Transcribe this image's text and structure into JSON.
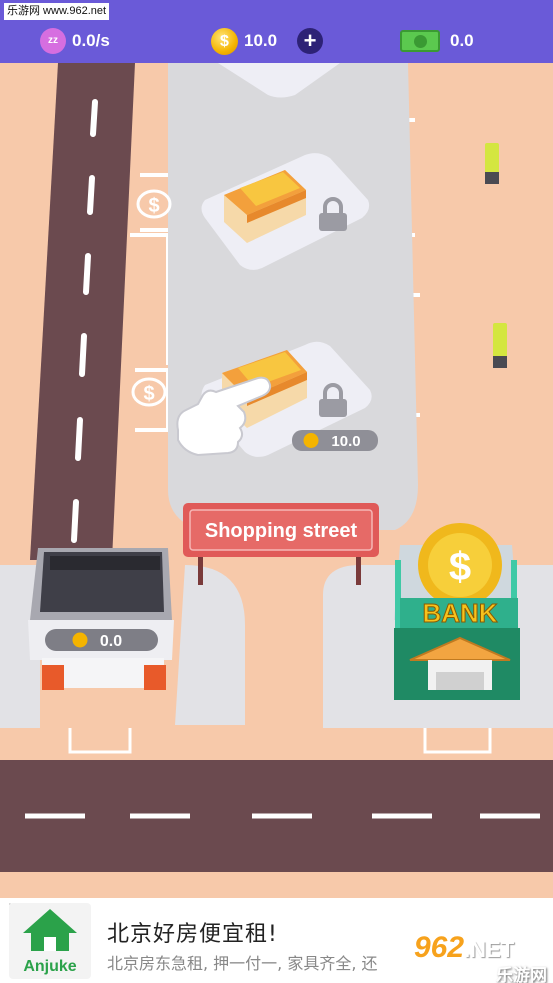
{
  "watermark_top": "乐游网 www.962.net",
  "hud": {
    "energy_rate": "0.0/s",
    "coins": "10.0",
    "plus_symbol": "+",
    "cash": "0.0"
  },
  "scene": {
    "sign_text": "Shopping street",
    "shop_lot_price": "10.0",
    "store_counter": "0.0",
    "bank_label": "BANK",
    "dollar_symbol": "$"
  },
  "ad": {
    "brand": "Anjuke",
    "title": "北京好房便宜租!",
    "subtitle": "北京房东急租, 押一付一, 家具齐全, 还"
  },
  "watermark_corner": {
    "logo": "962",
    "logo_suffix": ".NET",
    "site": "乐游网"
  },
  "colors": {
    "hud_bg": "#6a5ad8",
    "ground": "#f7c9aa",
    "road": "#6b4a4f",
    "plaza": "#d9d9dc",
    "sign_red": "#e05a58",
    "bank_green": "#1f8a64",
    "coin_gold": "#f4b400"
  }
}
